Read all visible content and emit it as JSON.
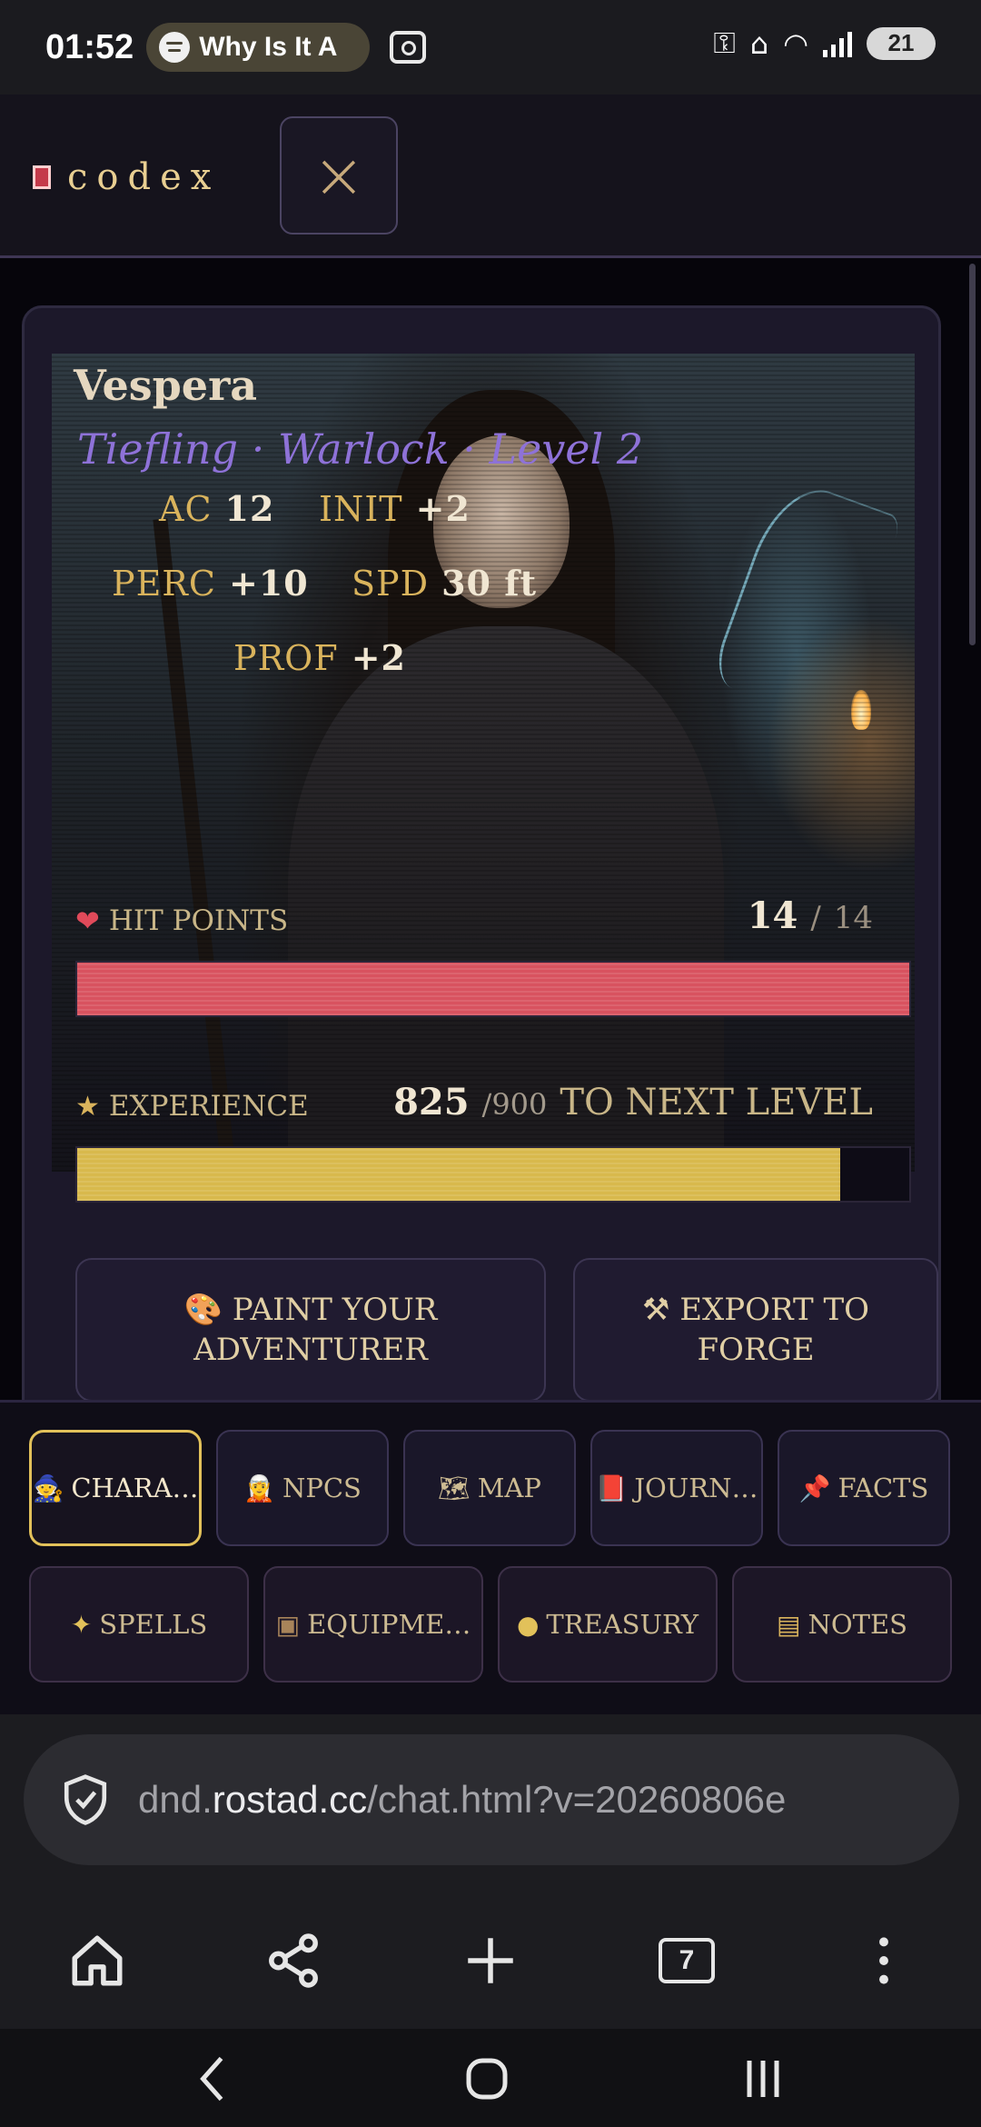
{
  "status_bar": {
    "time": "01:52",
    "media_title": "Why Is It A",
    "battery": "21"
  },
  "app": {
    "logo_text": "codex",
    "close_label": "×"
  },
  "character": {
    "name": "Vespera",
    "subtitle": "Tiefling · Warlock · Level 2",
    "stats": [
      {
        "label": "AC",
        "value": "12"
      },
      {
        "label": "INIT",
        "value": "+2"
      },
      {
        "label": "PERC",
        "value": "+10"
      },
      {
        "label": "SPD",
        "value": "30 ft"
      },
      {
        "label": "PROF",
        "value": "+2"
      }
    ],
    "hp": {
      "label": "HIT POINTS",
      "current": "14",
      "max": "14",
      "separator": "/",
      "fraction": 1.0
    },
    "xp": {
      "label": "EXPERIENCE",
      "current": "825",
      "max": "900",
      "separator": "/",
      "note": "TO NEXT LEVEL",
      "fraction": 0.917
    },
    "paint_button": "🎨 PAINT YOUR ADVENTURER",
    "export_button": "⚒ EXPORT TO FORGE"
  },
  "tabs": {
    "row1": [
      {
        "icon": "🧙",
        "label": "CHARA…",
        "active": true
      },
      {
        "icon": "🧝",
        "label": "NPCS"
      },
      {
        "icon": "🗺",
        "label": "MAP"
      },
      {
        "icon": "📕",
        "label": "JOURN…"
      },
      {
        "icon": "📌",
        "label": "FACTS"
      }
    ],
    "row2": [
      {
        "icon": "✦",
        "label": "SPELLS"
      },
      {
        "icon": "▣",
        "label": "EQUIPME…"
      },
      {
        "icon": "●",
        "label": "TREASURY"
      },
      {
        "icon": "▤",
        "label": "NOTES"
      }
    ]
  },
  "browser": {
    "url_prefix": "dnd.",
    "url_domain": "rostad.cc",
    "url_path": "/chat.html?v=20260806e",
    "tab_count": "7"
  },
  "colors": {
    "accent_gold": "#d9b35c",
    "subtitle_purple": "#8e72d8",
    "hp_red": "#d8525f",
    "xp_gold": "#d8b94c"
  }
}
